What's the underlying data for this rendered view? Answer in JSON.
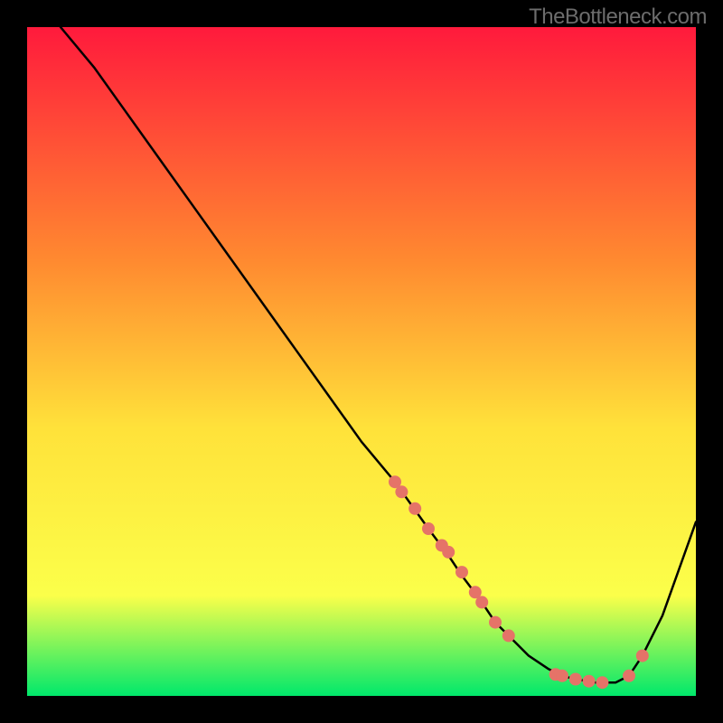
{
  "watermark": "TheBottleneck.com",
  "colors": {
    "gradient_top": "#ff1a3c",
    "gradient_mid1": "#ff8a30",
    "gradient_mid2": "#ffe23a",
    "gradient_mid3": "#fbff4a",
    "gradient_bottom": "#00e86b",
    "curve": "#000000",
    "marker_fill": "#e57368",
    "marker_stroke": "#d05a50",
    "background": "#000000"
  },
  "chart_data": {
    "type": "line",
    "title": "",
    "xlabel": "",
    "ylabel": "",
    "xlim": [
      0,
      100
    ],
    "ylim": [
      0,
      100
    ],
    "grid": false,
    "legend": false,
    "series": [
      {
        "name": "bottleneck-curve",
        "x": [
          5,
          10,
          15,
          20,
          25,
          30,
          35,
          40,
          45,
          50,
          55,
          60,
          63,
          65,
          68,
          70,
          72,
          75,
          78,
          80,
          82,
          85,
          88,
          90,
          92,
          95,
          100
        ],
        "y": [
          100,
          94,
          87,
          80,
          73,
          66,
          59,
          52,
          45,
          38,
          32,
          25,
          21,
          18,
          14,
          11,
          9,
          6,
          4,
          3,
          2.5,
          2,
          2,
          3,
          6,
          12,
          26
        ]
      }
    ],
    "markers": {
      "name": "highlight-points",
      "x": [
        55,
        56,
        58,
        60,
        62,
        63,
        65,
        67,
        68,
        70,
        72,
        79,
        80,
        82,
        84,
        86,
        90,
        92
      ],
      "y": [
        32,
        30.5,
        28,
        25,
        22.5,
        21.5,
        18.5,
        15.5,
        14,
        11,
        9,
        3.2,
        3,
        2.5,
        2.2,
        2,
        3,
        6
      ]
    }
  }
}
